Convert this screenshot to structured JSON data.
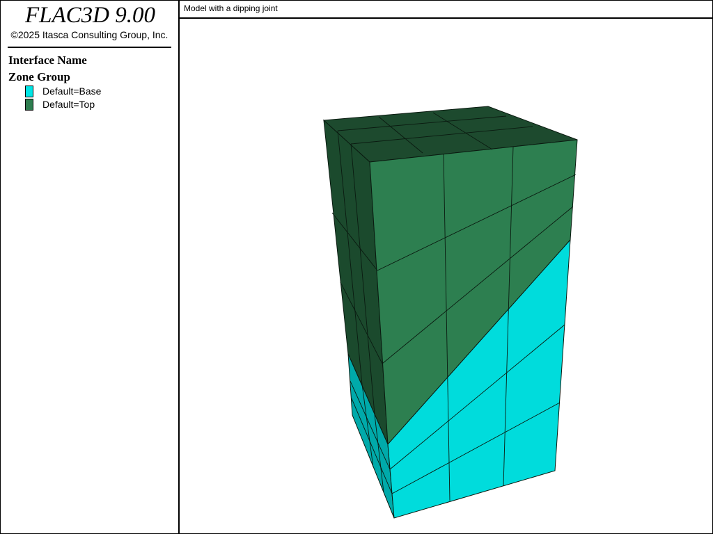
{
  "app": {
    "title": "FLAC3D 9.00",
    "copyright": "©2025 Itasca Consulting Group, Inc."
  },
  "legend": {
    "heading1": "Interface Name",
    "heading2": "Zone Group",
    "items": [
      {
        "label": "Default=Base",
        "color": "#00e5e5"
      },
      {
        "label": "Default=Top",
        "color": "#2e7d4f"
      }
    ]
  },
  "viewport": {
    "title": "Model with a dipping joint"
  },
  "colors": {
    "top_front": "#2d7f50",
    "top_side": "#1b4a2d",
    "top_cap": "#1d4a2e",
    "base_front": "#00dcdc",
    "base_side": "#00aaaa",
    "mesh_line": "#0a1a10"
  }
}
